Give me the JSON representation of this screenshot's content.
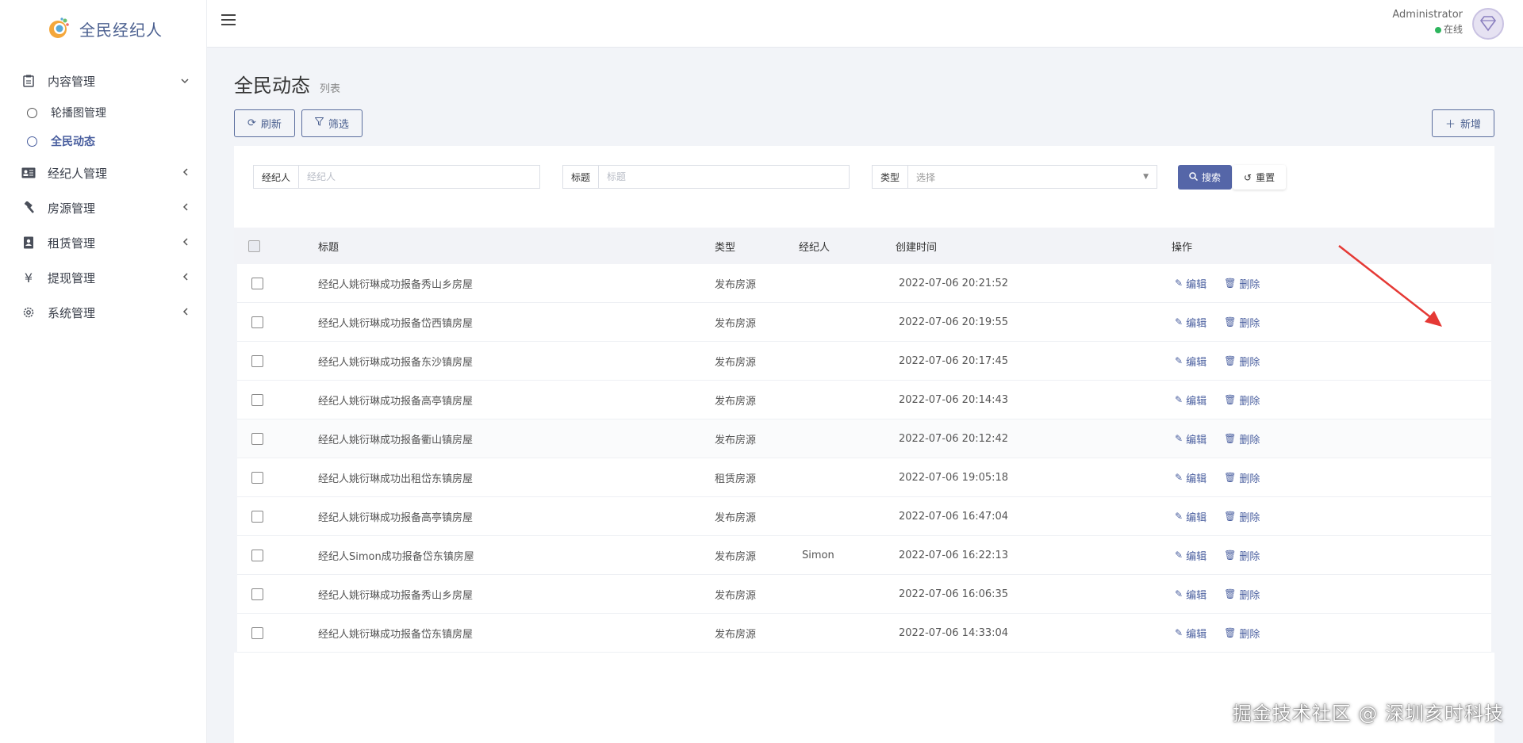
{
  "brand": {
    "title": "全民经纪人"
  },
  "sidebar": {
    "items": [
      {
        "label": "内容管理",
        "icon": "clipboard-icon",
        "arrow": "⌄",
        "expanded": true
      },
      {
        "label": "经纪人管理",
        "icon": "id-card-icon",
        "arrow": "‹"
      },
      {
        "label": "房源管理",
        "icon": "hammer-icon",
        "arrow": "‹"
      },
      {
        "label": "租赁管理",
        "icon": "contact-book-icon",
        "arrow": "‹"
      },
      {
        "label": "提现管理",
        "icon": "yen-icon",
        "arrow": "‹"
      },
      {
        "label": "系统管理",
        "icon": "gear-icon",
        "arrow": "‹"
      }
    ],
    "subitems": [
      {
        "label": "轮播图管理"
      },
      {
        "label": "全民动态",
        "active": true
      }
    ]
  },
  "user": {
    "name": "Administrator",
    "status": "在线"
  },
  "page": {
    "title": "全民动态",
    "subtitle": "列表"
  },
  "toolbar": {
    "refresh": "刷新",
    "filter": "筛选",
    "add": "新增"
  },
  "filters": {
    "agent_label": "经纪人",
    "agent_placeholder": "经纪人",
    "title_label": "标题",
    "title_placeholder": "标题",
    "type_label": "类型",
    "type_placeholder": "选择",
    "search": "搜索",
    "reset": "重置"
  },
  "table": {
    "headers": {
      "title": "标题",
      "type": "类型",
      "agent": "经纪人",
      "time": "创建时间",
      "ops": "操作"
    },
    "edit_label": "编辑",
    "delete_label": "删除",
    "rows": [
      {
        "title": "经纪人姚衍琳成功报备秀山乡房屋",
        "type": "发布房源",
        "agent": "",
        "time": "2022-07-06 20:21:52"
      },
      {
        "title": "经纪人姚衍琳成功报备岱西镇房屋",
        "type": "发布房源",
        "agent": "",
        "time": "2022-07-06 20:19:55"
      },
      {
        "title": "经纪人姚衍琳成功报备东沙镇房屋",
        "type": "发布房源",
        "agent": "",
        "time": "2022-07-06 20:17:45"
      },
      {
        "title": "经纪人姚衍琳成功报备高亭镇房屋",
        "type": "发布房源",
        "agent": "",
        "time": "2022-07-06 20:14:43"
      },
      {
        "title": "经纪人姚衍琳成功报备衢山镇房屋",
        "type": "发布房源",
        "agent": "",
        "time": "2022-07-06 20:12:42"
      },
      {
        "title": "经纪人姚衍琳成功出租岱东镇房屋",
        "type": "租赁房源",
        "agent": "",
        "time": "2022-07-06 19:05:18"
      },
      {
        "title": "经纪人姚衍琳成功报备高亭镇房屋",
        "type": "发布房源",
        "agent": "",
        "time": "2022-07-06 16:47:04"
      },
      {
        "title": "经纪人Simon成功报备岱东镇房屋",
        "type": "发布房源",
        "agent": "Simon",
        "time": "2022-07-06 16:22:13"
      },
      {
        "title": "经纪人姚衍琳成功报备秀山乡房屋",
        "type": "发布房源",
        "agent": "",
        "time": "2022-07-06 16:06:35"
      },
      {
        "title": "经纪人姚衍琳成功报备岱东镇房屋",
        "type": "发布房源",
        "agent": "",
        "time": "2022-07-06 14:33:04"
      }
    ]
  },
  "watermark": "掘金技术社区 @ 深圳亥时科技",
  "colors": {
    "accent": "#5566a8",
    "link": "#4a5f9f",
    "online": "#2db55d",
    "arrow": "#e53935"
  }
}
